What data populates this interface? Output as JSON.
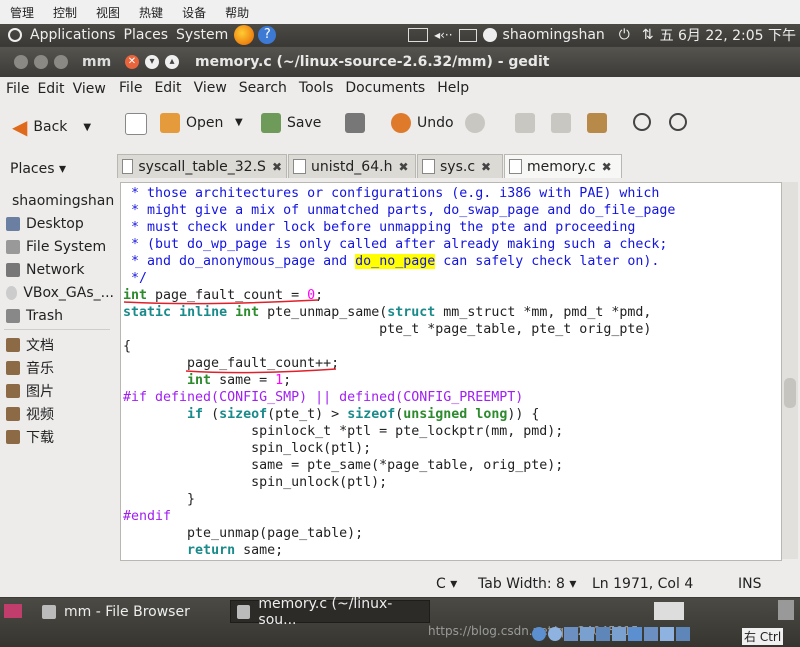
{
  "vbox_menu": [
    "管理",
    "控制",
    "视图",
    "热键",
    "设备",
    "帮助"
  ],
  "top_panel": {
    "menus": [
      "Applications",
      "Places",
      "System"
    ],
    "volume_icon": "◂‹··",
    "user": "shaomingshan",
    "clock": "五 6月 22, 2:05 下午"
  },
  "file_browser": {
    "title": "mm",
    "menu": [
      "File",
      "Edit",
      "View"
    ],
    "back_label": "Back",
    "places_label": "Places ▾",
    "places": [
      "shaomingshan",
      "Desktop",
      "File System",
      "Network",
      "VBox_GAs_...",
      "Trash"
    ],
    "bookmarks": [
      "文档",
      "音乐",
      "图片",
      "视频",
      "下载"
    ]
  },
  "gedit": {
    "title": "memory.c (~/linux-source-2.6.32/mm) - gedit",
    "menu": [
      "File",
      "Edit",
      "View",
      "Search",
      "Tools",
      "Documents",
      "Help"
    ],
    "toolbar": {
      "open": "Open",
      "save": "Save",
      "undo": "Undo"
    },
    "tabs": [
      "syscall_table_32.S",
      "unistd_64.h",
      "sys.c",
      "memory.c"
    ],
    "status": {
      "language": "C",
      "tab_width": "Tab Width: 8",
      "position": "Ln 1971, Col 4",
      "mode": "INS"
    }
  },
  "code": [
    [
      [
        "c-cmt",
        " * those architectures or configurations (e.g. i386 with PAE) which"
      ]
    ],
    [
      [
        "c-cmt",
        " * might give a mix of unmatched parts, do_swap_page and do_file_page"
      ]
    ],
    [
      [
        "c-cmt",
        " * must check under lock before unmapping the pte and proceeding"
      ]
    ],
    [
      [
        "c-cmt",
        " * (but do_wp_page is only called after already making such a check;"
      ]
    ],
    [
      [
        "c-cmt",
        " * and do_anonymous_page and "
      ],
      [
        "c-cmt hl",
        "do_no_page"
      ],
      [
        "c-cmt",
        " can safely check later on)."
      ]
    ],
    [
      [
        "c-cmt",
        " */"
      ]
    ],
    [
      [
        "c-typ",
        "int"
      ],
      [
        "",
        " page_fault_count = "
      ],
      [
        "c-num",
        "0"
      ],
      [
        "",
        ";"
      ]
    ],
    [
      [
        "c-key",
        "static"
      ],
      [
        "",
        " "
      ],
      [
        "c-key",
        "inline"
      ],
      [
        "",
        " "
      ],
      [
        "c-typ",
        "int"
      ],
      [
        "",
        " pte_unmap_same("
      ],
      [
        "c-key",
        "struct"
      ],
      [
        "",
        " mm_struct *mm, pmd_t *pmd,"
      ]
    ],
    [
      [
        "",
        "                                pte_t *page_table, pte_t orig_pte)"
      ]
    ],
    [
      [
        "",
        "{"
      ]
    ],
    [
      [
        "",
        "        page_fault_count++;"
      ]
    ],
    [
      [
        "",
        "        "
      ],
      [
        "c-typ",
        "int"
      ],
      [
        "",
        " same = "
      ],
      [
        "c-num",
        "1"
      ],
      [
        "",
        ";"
      ]
    ],
    [
      [
        "c-pre",
        "#if defined(CONFIG_SMP) || defined(CONFIG_PREEMPT)"
      ]
    ],
    [
      [
        "",
        "        "
      ],
      [
        "c-key",
        "if"
      ],
      [
        "",
        " ("
      ],
      [
        "c-key",
        "sizeof"
      ],
      [
        "",
        "(pte_t) > "
      ],
      [
        "c-key",
        "sizeof"
      ],
      [
        "",
        "("
      ],
      [
        "c-typ",
        "unsigned"
      ],
      [
        "",
        " "
      ],
      [
        "c-typ",
        "long"
      ],
      [
        "",
        ")) {"
      ]
    ],
    [
      [
        "",
        "                spinlock_t *ptl = pte_lockptr(mm, pmd);"
      ]
    ],
    [
      [
        "",
        "                spin_lock(ptl);"
      ]
    ],
    [
      [
        "",
        "                same = pte_same(*page_table, orig_pte);"
      ]
    ],
    [
      [
        "",
        "                spin_unlock(ptl);"
      ]
    ],
    [
      [
        "",
        "        }"
      ]
    ],
    [
      [
        "c-pre",
        "#endif"
      ]
    ],
    [
      [
        "",
        "        pte_unmap(page_table);"
      ]
    ],
    [
      [
        "",
        "        "
      ],
      [
        "c-key",
        "return"
      ],
      [
        "",
        " same;"
      ]
    ],
    [
      [
        "",
        "}"
      ]
    ]
  ],
  "taskbar": {
    "items": [
      "mm - File Browser",
      "memory.c (~/linux-sou..."
    ],
    "watermark": "https://blog.csdn.net/qq_24045015",
    "host_key": "右 Ctrl"
  }
}
